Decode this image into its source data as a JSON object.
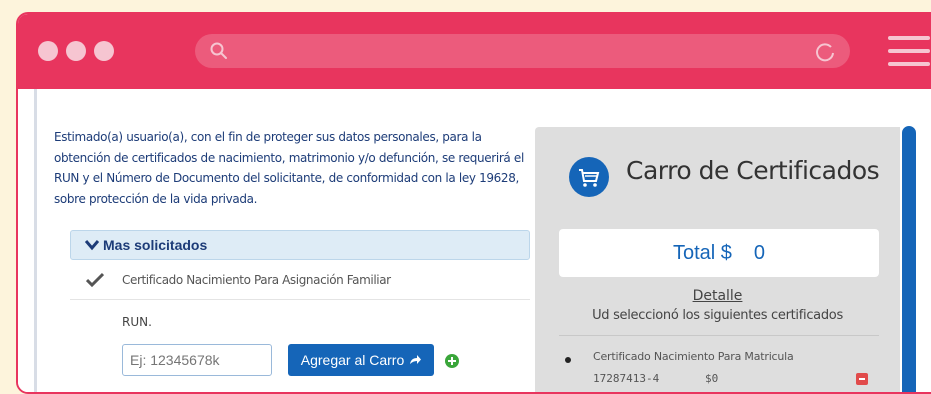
{
  "browser": {
    "dots": 3,
    "icons": [
      "search-icon",
      "reload-icon",
      "menu-icon"
    ],
    "accent": "#e8355e"
  },
  "form": {
    "intro_text": "Estimado(a) usuario(a), con el fin de proteger sus datos personales, para la obtención de certificados de nacimiento, matrimonio y/o defunción, se requerirá el RUN y el Número de Documento del solicitante, de conformidad con la ley 19628, sobre protección de la vida privada.",
    "section_label": "Mas solicitados",
    "certificate_label": "Certificado Nacimiento Para Asignación Familiar",
    "certificate_checked": true,
    "run_label": "RUN.",
    "run_placeholder": "Ej: 12345678k",
    "add_button_label": "Agregar al Carro"
  },
  "cart": {
    "title": "Carro de Certificados",
    "total_label": "Total $",
    "total_value": "0",
    "detail_label": "Detalle",
    "detail_subtitle": "Ud seleccionó los siguientes certificados",
    "items": [
      {
        "name": "Certificado Nacimiento Para Matricula",
        "run": "17287413-4",
        "price": "$0"
      }
    ],
    "brand_color": "#1565b8"
  }
}
